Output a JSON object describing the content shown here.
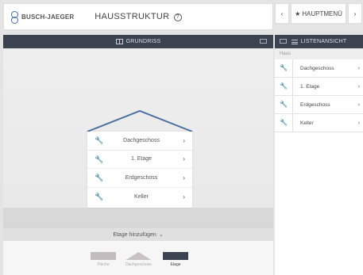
{
  "header": {
    "logo_text": "BUSCH-JAEGER",
    "title": "HAUSSTRUKTUR",
    "help_icon": "?",
    "nav_prev": "‹",
    "nav_main": "HAUPTMENÜ",
    "nav_next": "›"
  },
  "main": {
    "view_title": "GRUNDRISS",
    "floors": [
      {
        "name": "Dachgeschoss",
        "chevron": "›"
      },
      {
        "name": "1. Etage",
        "chevron": "›"
      },
      {
        "name": "Erdgeschoss",
        "chevron": "›"
      },
      {
        "name": "Keller",
        "chevron": "›"
      }
    ],
    "add_floor_label": "Etage hinzufügen",
    "add_floor_chevron": "⌄",
    "views": [
      {
        "label": "Fläche",
        "active": false
      },
      {
        "label": "Dachgeschoss",
        "active": false
      },
      {
        "label": "Etage",
        "active": true
      }
    ]
  },
  "side": {
    "view_title": "LISTENANSICHT",
    "breadcrumb": "Haus",
    "items": [
      {
        "name": "Dachgeschoss",
        "chevron": "›"
      },
      {
        "name": "1. Etage",
        "chevron": "›"
      },
      {
        "name": "Erdgeschoss",
        "chevron": "›"
      },
      {
        "name": "Keller",
        "chevron": "›"
      }
    ]
  },
  "colors": {
    "header_dark": "#3b4350",
    "roof_blue": "#4b6f9f",
    "background": "#e4e4e4",
    "panel_white": "#ffffff"
  },
  "icons": {
    "logo": "busch-jaeger-logo",
    "help": "help-circle-icon",
    "nav_prev": "chevron-left-icon",
    "nav_main": "star-icon",
    "nav_next": "chevron-right-icon",
    "floor": "wrench-icon",
    "grid": "grid-view-icon",
    "list": "list-view-icon"
  }
}
